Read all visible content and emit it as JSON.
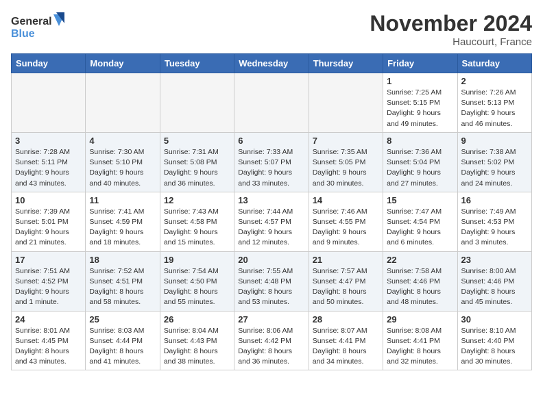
{
  "logo": {
    "general": "General",
    "blue": "Blue"
  },
  "title": "November 2024",
  "location": "Haucourt, France",
  "days_header": [
    "Sunday",
    "Monday",
    "Tuesday",
    "Wednesday",
    "Thursday",
    "Friday",
    "Saturday"
  ],
  "weeks": [
    [
      {
        "day": "",
        "info": ""
      },
      {
        "day": "",
        "info": ""
      },
      {
        "day": "",
        "info": ""
      },
      {
        "day": "",
        "info": ""
      },
      {
        "day": "",
        "info": ""
      },
      {
        "day": "1",
        "info": "Sunrise: 7:25 AM\nSunset: 5:15 PM\nDaylight: 9 hours\nand 49 minutes."
      },
      {
        "day": "2",
        "info": "Sunrise: 7:26 AM\nSunset: 5:13 PM\nDaylight: 9 hours\nand 46 minutes."
      }
    ],
    [
      {
        "day": "3",
        "info": "Sunrise: 7:28 AM\nSunset: 5:11 PM\nDaylight: 9 hours\nand 43 minutes."
      },
      {
        "day": "4",
        "info": "Sunrise: 7:30 AM\nSunset: 5:10 PM\nDaylight: 9 hours\nand 40 minutes."
      },
      {
        "day": "5",
        "info": "Sunrise: 7:31 AM\nSunset: 5:08 PM\nDaylight: 9 hours\nand 36 minutes."
      },
      {
        "day": "6",
        "info": "Sunrise: 7:33 AM\nSunset: 5:07 PM\nDaylight: 9 hours\nand 33 minutes."
      },
      {
        "day": "7",
        "info": "Sunrise: 7:35 AM\nSunset: 5:05 PM\nDaylight: 9 hours\nand 30 minutes."
      },
      {
        "day": "8",
        "info": "Sunrise: 7:36 AM\nSunset: 5:04 PM\nDaylight: 9 hours\nand 27 minutes."
      },
      {
        "day": "9",
        "info": "Sunrise: 7:38 AM\nSunset: 5:02 PM\nDaylight: 9 hours\nand 24 minutes."
      }
    ],
    [
      {
        "day": "10",
        "info": "Sunrise: 7:39 AM\nSunset: 5:01 PM\nDaylight: 9 hours\nand 21 minutes."
      },
      {
        "day": "11",
        "info": "Sunrise: 7:41 AM\nSunset: 4:59 PM\nDaylight: 9 hours\nand 18 minutes."
      },
      {
        "day": "12",
        "info": "Sunrise: 7:43 AM\nSunset: 4:58 PM\nDaylight: 9 hours\nand 15 minutes."
      },
      {
        "day": "13",
        "info": "Sunrise: 7:44 AM\nSunset: 4:57 PM\nDaylight: 9 hours\nand 12 minutes."
      },
      {
        "day": "14",
        "info": "Sunrise: 7:46 AM\nSunset: 4:55 PM\nDaylight: 9 hours\nand 9 minutes."
      },
      {
        "day": "15",
        "info": "Sunrise: 7:47 AM\nSunset: 4:54 PM\nDaylight: 9 hours\nand 6 minutes."
      },
      {
        "day": "16",
        "info": "Sunrise: 7:49 AM\nSunset: 4:53 PM\nDaylight: 9 hours\nand 3 minutes."
      }
    ],
    [
      {
        "day": "17",
        "info": "Sunrise: 7:51 AM\nSunset: 4:52 PM\nDaylight: 9 hours\nand 1 minute."
      },
      {
        "day": "18",
        "info": "Sunrise: 7:52 AM\nSunset: 4:51 PM\nDaylight: 8 hours\nand 58 minutes."
      },
      {
        "day": "19",
        "info": "Sunrise: 7:54 AM\nSunset: 4:50 PM\nDaylight: 8 hours\nand 55 minutes."
      },
      {
        "day": "20",
        "info": "Sunrise: 7:55 AM\nSunset: 4:48 PM\nDaylight: 8 hours\nand 53 minutes."
      },
      {
        "day": "21",
        "info": "Sunrise: 7:57 AM\nSunset: 4:47 PM\nDaylight: 8 hours\nand 50 minutes."
      },
      {
        "day": "22",
        "info": "Sunrise: 7:58 AM\nSunset: 4:46 PM\nDaylight: 8 hours\nand 48 minutes."
      },
      {
        "day": "23",
        "info": "Sunrise: 8:00 AM\nSunset: 4:46 PM\nDaylight: 8 hours\nand 45 minutes."
      }
    ],
    [
      {
        "day": "24",
        "info": "Sunrise: 8:01 AM\nSunset: 4:45 PM\nDaylight: 8 hours\nand 43 minutes."
      },
      {
        "day": "25",
        "info": "Sunrise: 8:03 AM\nSunset: 4:44 PM\nDaylight: 8 hours\nand 41 minutes."
      },
      {
        "day": "26",
        "info": "Sunrise: 8:04 AM\nSunset: 4:43 PM\nDaylight: 8 hours\nand 38 minutes."
      },
      {
        "day": "27",
        "info": "Sunrise: 8:06 AM\nSunset: 4:42 PM\nDaylight: 8 hours\nand 36 minutes."
      },
      {
        "day": "28",
        "info": "Sunrise: 8:07 AM\nSunset: 4:41 PM\nDaylight: 8 hours\nand 34 minutes."
      },
      {
        "day": "29",
        "info": "Sunrise: 8:08 AM\nSunset: 4:41 PM\nDaylight: 8 hours\nand 32 minutes."
      },
      {
        "day": "30",
        "info": "Sunrise: 8:10 AM\nSunset: 4:40 PM\nDaylight: 8 hours\nand 30 minutes."
      }
    ]
  ]
}
